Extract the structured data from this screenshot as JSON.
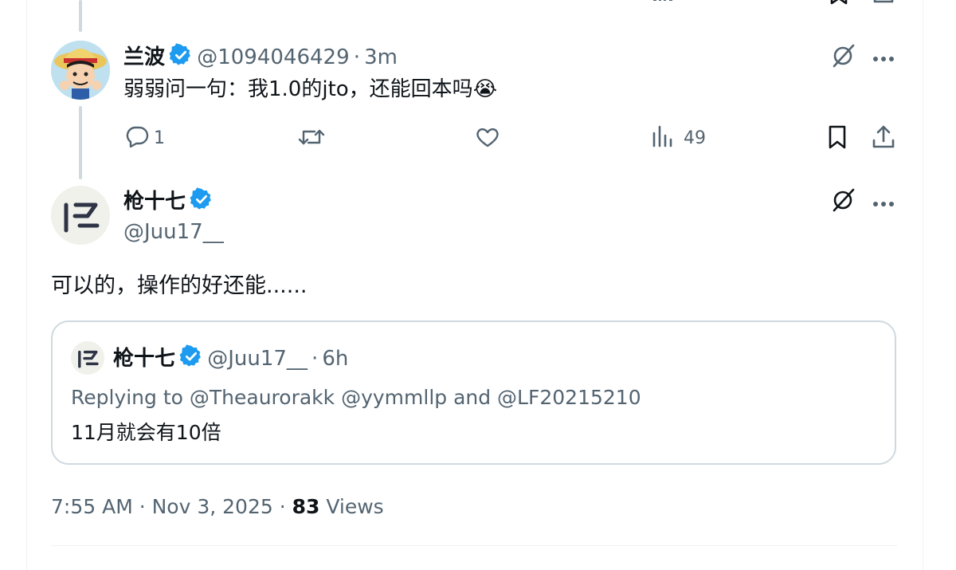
{
  "reply_tweet": {
    "display_name": "兰波",
    "handle": "@1094046429",
    "separator": "·",
    "time": "3m",
    "text": "弱弱问一句：我1.0的jto，还能回本吗",
    "emoji": "😭",
    "actions": {
      "reply_count": "1",
      "retweet_count": "",
      "like_count": "",
      "views_count": "49"
    }
  },
  "main_tweet": {
    "display_name": "枪十七",
    "handle": "@Juu17__",
    "text": "可以的，操作的好还能......",
    "timestamp": "7:55 AM · Nov 3, 2025 · ",
    "views_count": "83",
    "views_label": " Views"
  },
  "quoted_tweet": {
    "display_name": "枪十七",
    "handle": "@Juu17__",
    "separator": "·",
    "time": "6h",
    "replying_prefix": "Replying to ",
    "replying_to": "@Theaurorakk @yymmllp and @LF20215210",
    "text": "11月就会有10倍"
  },
  "colors": {
    "verified": "#1d9bf0",
    "link": "#1d9bf0",
    "secondary_text": "#536471",
    "thread_line": "#cfd9de"
  },
  "icons": [
    "reply-icon",
    "retweet-icon",
    "like-icon",
    "views-icon",
    "bookmark-icon",
    "share-icon",
    "grok-icon",
    "more-icon",
    "verified-badge-icon"
  ]
}
